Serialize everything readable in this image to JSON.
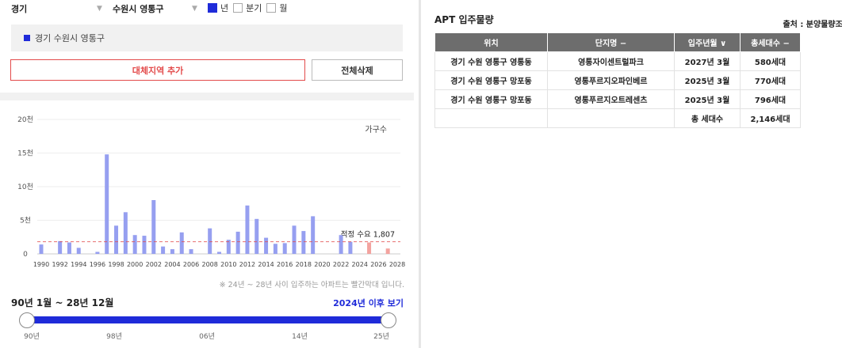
{
  "filters": {
    "province": "경기",
    "city": "수원시 영통구",
    "period": [
      {
        "label": "년",
        "checked": true
      },
      {
        "label": "분기",
        "checked": false
      },
      {
        "label": "월",
        "checked": false
      }
    ]
  },
  "region": {
    "label": "경기 수원시 영통구"
  },
  "buttons": {
    "add": "대체지역 추가",
    "delete": "전체삭제"
  },
  "chart_data": {
    "type": "bar",
    "legend": "가구수",
    "ylim": [
      0,
      20000
    ],
    "y_ticks": [
      {
        "value": 0,
        "label": "0"
      },
      {
        "value": 5000,
        "label": "5천"
      },
      {
        "value": 10000,
        "label": "10천"
      },
      {
        "value": 15000,
        "label": "15천"
      },
      {
        "value": 20000,
        "label": "20천"
      }
    ],
    "x_labels": [
      "1990",
      "1992",
      "1994",
      "1996",
      "1998",
      "2000",
      "2002",
      "2004",
      "2006",
      "2008",
      "2010",
      "2012",
      "2014",
      "2016",
      "2018",
      "2020",
      "2022",
      "2024",
      "2026",
      "2028"
    ],
    "x": [
      1990,
      1991,
      1992,
      1993,
      1994,
      1995,
      1996,
      1997,
      1998,
      1999,
      2000,
      2001,
      2002,
      2003,
      2004,
      2005,
      2006,
      2007,
      2008,
      2009,
      2010,
      2011,
      2012,
      2013,
      2014,
      2015,
      2016,
      2017,
      2018,
      2019,
      2020,
      2021,
      2022,
      2023,
      2024,
      2025,
      2026,
      2027,
      2028
    ],
    "values": [
      1400,
      0,
      1900,
      1700,
      900,
      0,
      300,
      14800,
      4200,
      6200,
      2800,
      2700,
      8000,
      1100,
      700,
      3200,
      700,
      0,
      3800,
      300,
      2100,
      3300,
      7200,
      5200,
      2400,
      1500,
      1600,
      4200,
      3400,
      5600,
      0,
      0,
      2800,
      1800,
      0,
      1700,
      0,
      800,
      0
    ],
    "forecast_from": 2024,
    "series_color": "#969ff0",
    "forecast_color": "#f3a39f",
    "reference_line": {
      "value": 1807,
      "label": "적정 수요 1,807",
      "color": "#e34b4b"
    }
  },
  "note": "※ 24년 ~ 28년 사이 입주하는 아파트는 빨간막대 입니다.",
  "range": {
    "title": "90년 1월 ~ 28년 12월",
    "link": "2024년 이후 보기",
    "ticks": [
      "90년",
      "98년",
      "06년",
      "14년",
      "25년"
    ]
  },
  "apt": {
    "title": "APT 입주물량",
    "source": "출처 : 분양물량조사",
    "headers": [
      "위치",
      "단지명 −",
      "입주년월 ∨",
      "총세대수 −"
    ],
    "rows": [
      [
        "경기 수원 영통구 영통동",
        "영통자이센트럴파크",
        "2027년 3월",
        "580세대"
      ],
      [
        "경기 수원 영통구 망포동",
        "영통푸르지오파인베르",
        "2025년 3월",
        "770세대"
      ],
      [
        "경기 수원 영통구 망포동",
        "영통푸르지오트레센츠",
        "2025년 3월",
        "796세대"
      ]
    ],
    "total_label": "총 세대수",
    "total_value": "2,146세대"
  }
}
